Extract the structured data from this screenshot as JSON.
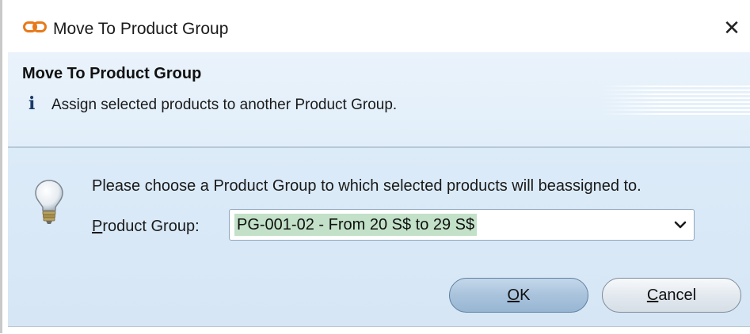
{
  "window": {
    "title": "Move To Product Group",
    "close_glyph": "✕"
  },
  "banner": {
    "title": "Move To Product Group",
    "info_glyph": "i",
    "description": "Assign selected products to another Product Group."
  },
  "body": {
    "prompt": "Please choose a Product Group to which selected products will beassigned to.",
    "product_group_label_mnemonic": "P",
    "product_group_label_rest": "roduct Group:",
    "product_group_value": "PG-001-02 - From 20 S$ to 29 S$"
  },
  "buttons": {
    "ok_mnemonic": "O",
    "ok_rest": "K",
    "cancel_mnemonic": "C",
    "cancel_rest": "ancel"
  },
  "icons": {
    "app": "link-chain-icon",
    "info": "info-icon",
    "hint": "lightbulb-icon",
    "dropdown": "chevron-down-icon",
    "close": "close-icon"
  },
  "colors": {
    "banner_bg": "#e4f0fa",
    "body_bg": "#d9e9f7",
    "app_icon": "#e8791a",
    "selection_highlight": "#c2e1c8"
  }
}
